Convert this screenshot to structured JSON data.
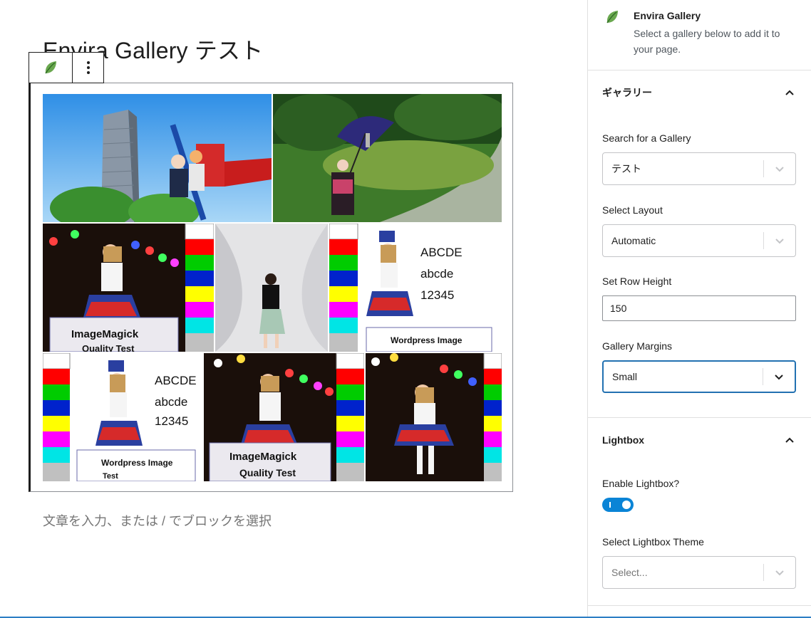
{
  "post": {
    "title": "Envira Gallery テスト",
    "paragraph_placeholder": "文章を入力、または / でブロックを選択"
  },
  "toolbar": {
    "icons": [
      "envira-leaf-icon",
      "more-options-icon"
    ]
  },
  "gallery": {
    "photos": [
      {
        "name": "skyscraper-cosplay",
        "texts": []
      },
      {
        "name": "umbrella-garden",
        "texts": []
      },
      {
        "name": "stage-lights",
        "texts": [
          "ImageMagick",
          "Quality Test"
        ]
      },
      {
        "name": "studio-girl",
        "texts": []
      },
      {
        "name": "wordpress-test",
        "texts": [
          "ABCDE",
          "abcde",
          "12345",
          "Wordpress Image"
        ]
      },
      {
        "name": "wordpress-test-2",
        "texts": [
          "ABCDE",
          "abcde",
          "12345",
          "Wordpress Image",
          "Test"
        ]
      },
      {
        "name": "stage-lights-2",
        "texts": [
          "ImageMagick",
          "Quality Test"
        ]
      },
      {
        "name": "stage-lights-3",
        "texts": []
      }
    ]
  },
  "sidebar": {
    "block_card": {
      "title": "Envira Gallery",
      "description": "Select a gallery below to add it to your page."
    },
    "gallery_panel": {
      "title": "ギャラリー",
      "search_label": "Search for a Gallery",
      "search_value": "テスト",
      "layout_label": "Select Layout",
      "layout_value": "Automatic",
      "row_height_label": "Set Row Height",
      "row_height_value": "150",
      "margins_label": "Gallery Margins",
      "margins_value": "Small"
    },
    "lightbox_panel": {
      "title": "Lightbox",
      "enable_label": "Enable Lightbox?",
      "enabled": true,
      "theme_label": "Select Lightbox Theme",
      "theme_placeholder": "Select..."
    }
  },
  "colors": {
    "accent": "#2271b1",
    "toggle_on": "#0a84d6",
    "leaf_green": "#6aa84f"
  }
}
